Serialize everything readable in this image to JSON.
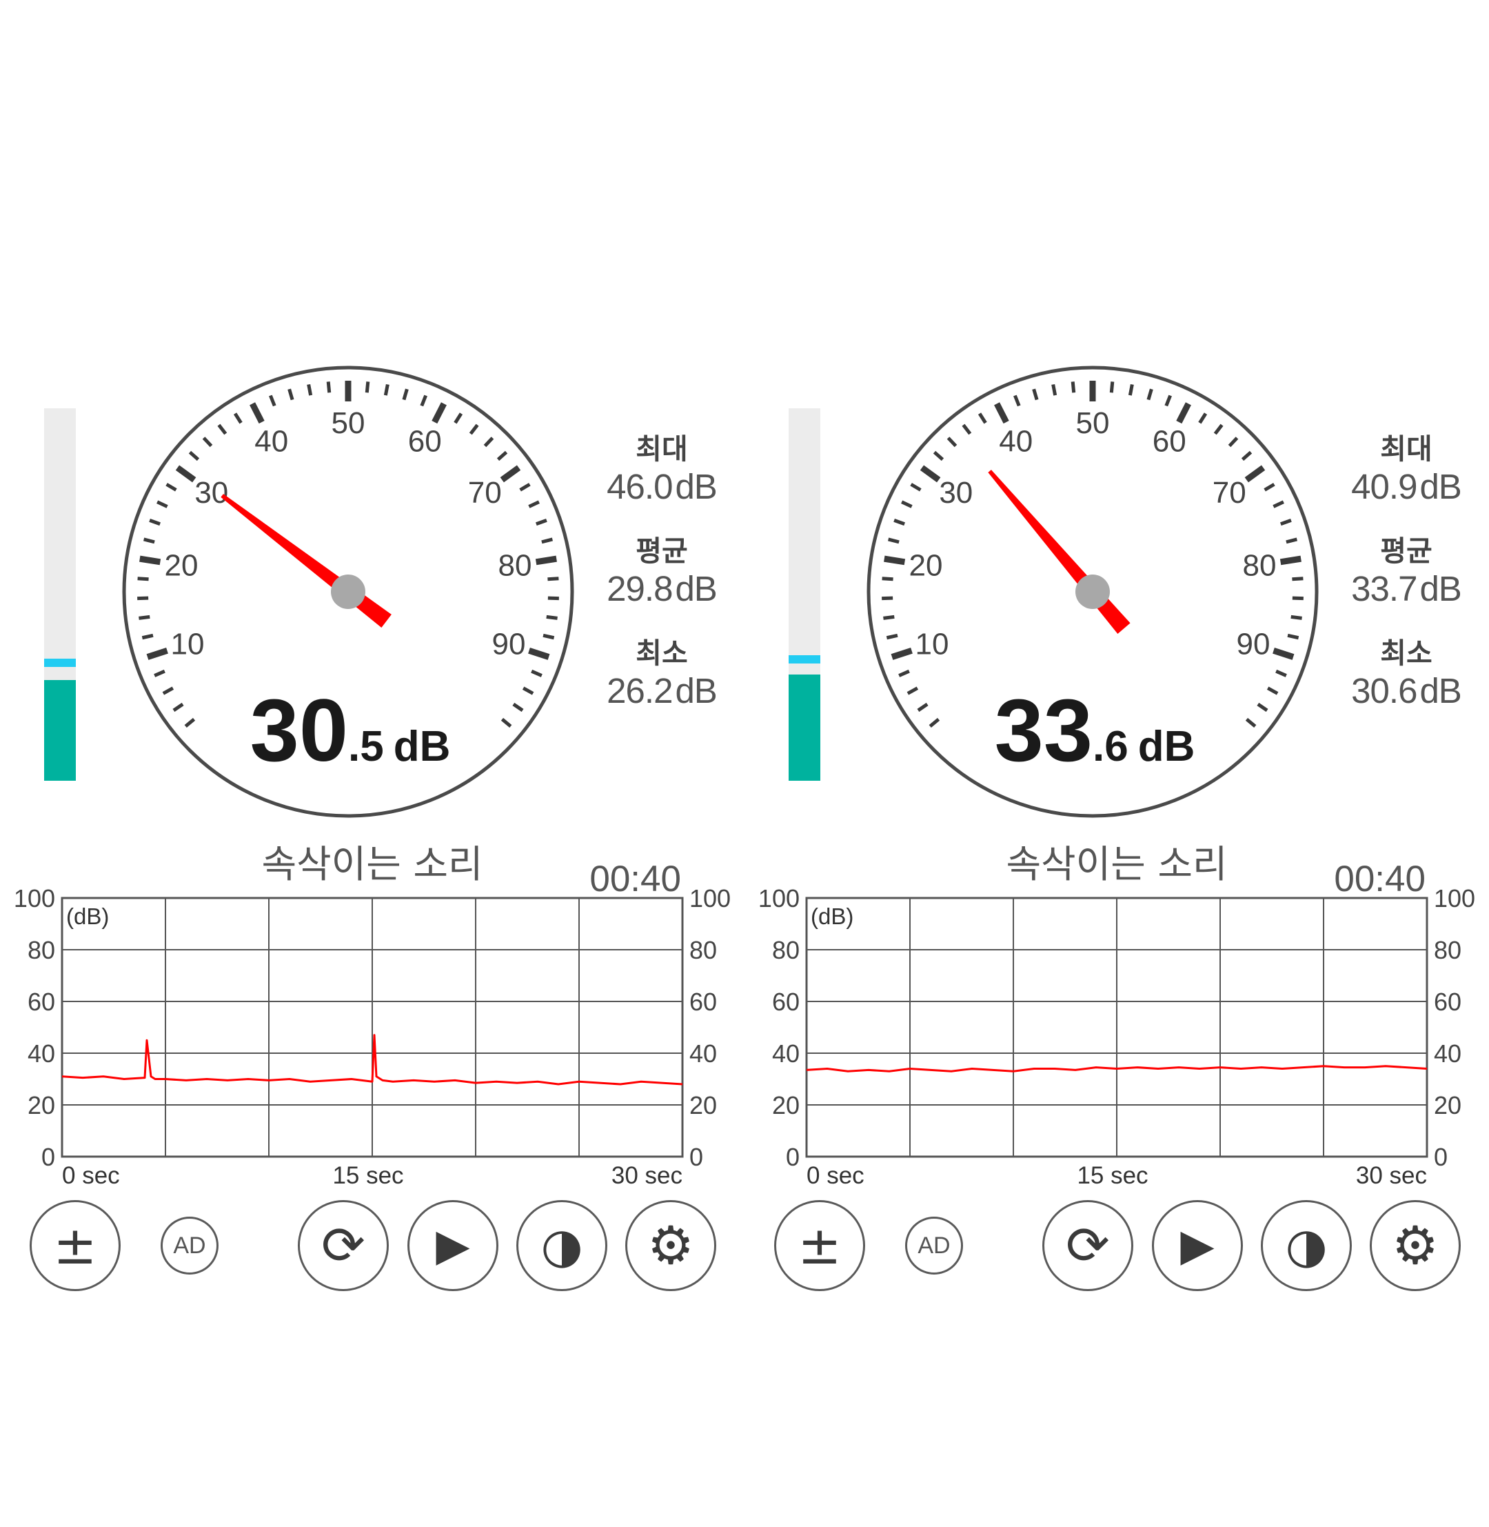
{
  "meters": [
    {
      "reading": {
        "integer": "30",
        "decimal": ".5",
        "unit": "dB"
      },
      "needle_db": 30.5,
      "level_fill_db": 27,
      "level_peak_db": 30.5,
      "gauge": {
        "db_min": 0,
        "db_max": 100,
        "labels": [
          "10",
          "20",
          "30",
          "40",
          "50",
          "60",
          "70",
          "80",
          "90"
        ],
        "label_values": [
          10,
          20,
          30,
          40,
          50,
          60,
          70,
          80,
          90
        ]
      },
      "stats": [
        {
          "label": "최대",
          "value": "46.0",
          "unit": "dB"
        },
        {
          "label": "평균",
          "value": "29.8",
          "unit": "dB"
        },
        {
          "label": "최소",
          "value": "26.2",
          "unit": "dB"
        }
      ],
      "mode_title": "속삭이는 소리",
      "timer": "00:40",
      "chart_data": {
        "type": "line",
        "ylabel": "(dB)",
        "ylim": [
          0,
          100
        ],
        "y_ticks": [
          "100",
          "80",
          "60",
          "40",
          "20",
          "0"
        ],
        "y_tick_values": [
          100,
          80,
          60,
          40,
          20,
          0
        ],
        "x_ticks": [
          "0 sec",
          "15 sec",
          "30 sec"
        ],
        "xlim": [
          0,
          30
        ],
        "grid": true,
        "series": [
          {
            "color": "#ff0000",
            "x": [
              0,
              1,
              2,
              3,
              4,
              4.1,
              4.3,
              4.5,
              5,
              6,
              7,
              8,
              9,
              10,
              11,
              12,
              13,
              14,
              15,
              15.1,
              15.2,
              15.5,
              16,
              17,
              18,
              19,
              20,
              21,
              22,
              23,
              24,
              25,
              26,
              27,
              28,
              29,
              30
            ],
            "y": [
              31,
              30.5,
              31,
              30,
              30.5,
              45,
              31,
              30,
              30,
              29.5,
              30,
              29.5,
              30,
              29.5,
              30,
              29,
              29.5,
              30,
              29,
              47,
              31,
              29.5,
              29,
              29.5,
              29,
              29.5,
              28.5,
              29,
              28.5,
              29,
              28,
              29,
              28.5,
              28,
              29,
              28.5,
              28
            ]
          }
        ]
      },
      "buttons": [
        {
          "icon": "plus-minus-icon",
          "glyph": "±"
        },
        {
          "icon": "ad-icon",
          "label": "AD"
        },
        {
          "icon": "refresh-icon",
          "glyph": "⟳"
        },
        {
          "icon": "play-icon",
          "glyph": "▶"
        },
        {
          "icon": "contrast-icon",
          "glyph": "◑"
        },
        {
          "icon": "gear-icon",
          "glyph": "⚙"
        }
      ]
    },
    {
      "reading": {
        "integer": "33",
        "decimal": ".6",
        "unit": "dB"
      },
      "needle_db": 35,
      "level_fill_db": 28.5,
      "level_peak_db": 31.5,
      "gauge": {
        "db_min": 0,
        "db_max": 100,
        "labels": [
          "10",
          "20",
          "30",
          "40",
          "50",
          "60",
          "70",
          "80",
          "90"
        ],
        "label_values": [
          10,
          20,
          30,
          40,
          50,
          60,
          70,
          80,
          90
        ]
      },
      "stats": [
        {
          "label": "최대",
          "value": "40.9",
          "unit": "dB"
        },
        {
          "label": "평균",
          "value": "33.7",
          "unit": "dB"
        },
        {
          "label": "최소",
          "value": "30.6",
          "unit": "dB"
        }
      ],
      "mode_title": "속삭이는 소리",
      "timer": "00:40",
      "chart_data": {
        "type": "line",
        "ylabel": "(dB)",
        "ylim": [
          0,
          100
        ],
        "y_ticks": [
          "100",
          "80",
          "60",
          "40",
          "20",
          "0"
        ],
        "y_tick_values": [
          100,
          80,
          60,
          40,
          20,
          0
        ],
        "x_ticks": [
          "0 sec",
          "15 sec",
          "30 sec"
        ],
        "xlim": [
          0,
          30
        ],
        "grid": true,
        "series": [
          {
            "color": "#ff0000",
            "x": [
              0,
              1,
              2,
              3,
              4,
              5,
              6,
              7,
              8,
              9,
              10,
              11,
              12,
              13,
              14,
              15,
              16,
              17,
              18,
              19,
              20,
              21,
              22,
              23,
              24,
              25,
              26,
              27,
              28,
              29,
              30
            ],
            "y": [
              33.5,
              34,
              33,
              33.5,
              33,
              34,
              33.5,
              33,
              34,
              33.5,
              33,
              34,
              34,
              33.5,
              34.5,
              34,
              34.5,
              34,
              34.5,
              34,
              34.5,
              34,
              34.5,
              34,
              34.5,
              35,
              34.5,
              34.5,
              35,
              34.5,
              34
            ]
          }
        ]
      },
      "buttons": [
        {
          "icon": "plus-minus-icon",
          "glyph": "±"
        },
        {
          "icon": "ad-icon",
          "label": "AD"
        },
        {
          "icon": "refresh-icon",
          "glyph": "⟳"
        },
        {
          "icon": "play-icon",
          "glyph": "▶"
        },
        {
          "icon": "contrast-icon",
          "glyph": "◑"
        },
        {
          "icon": "gear-icon",
          "glyph": "⚙"
        }
      ]
    }
  ]
}
